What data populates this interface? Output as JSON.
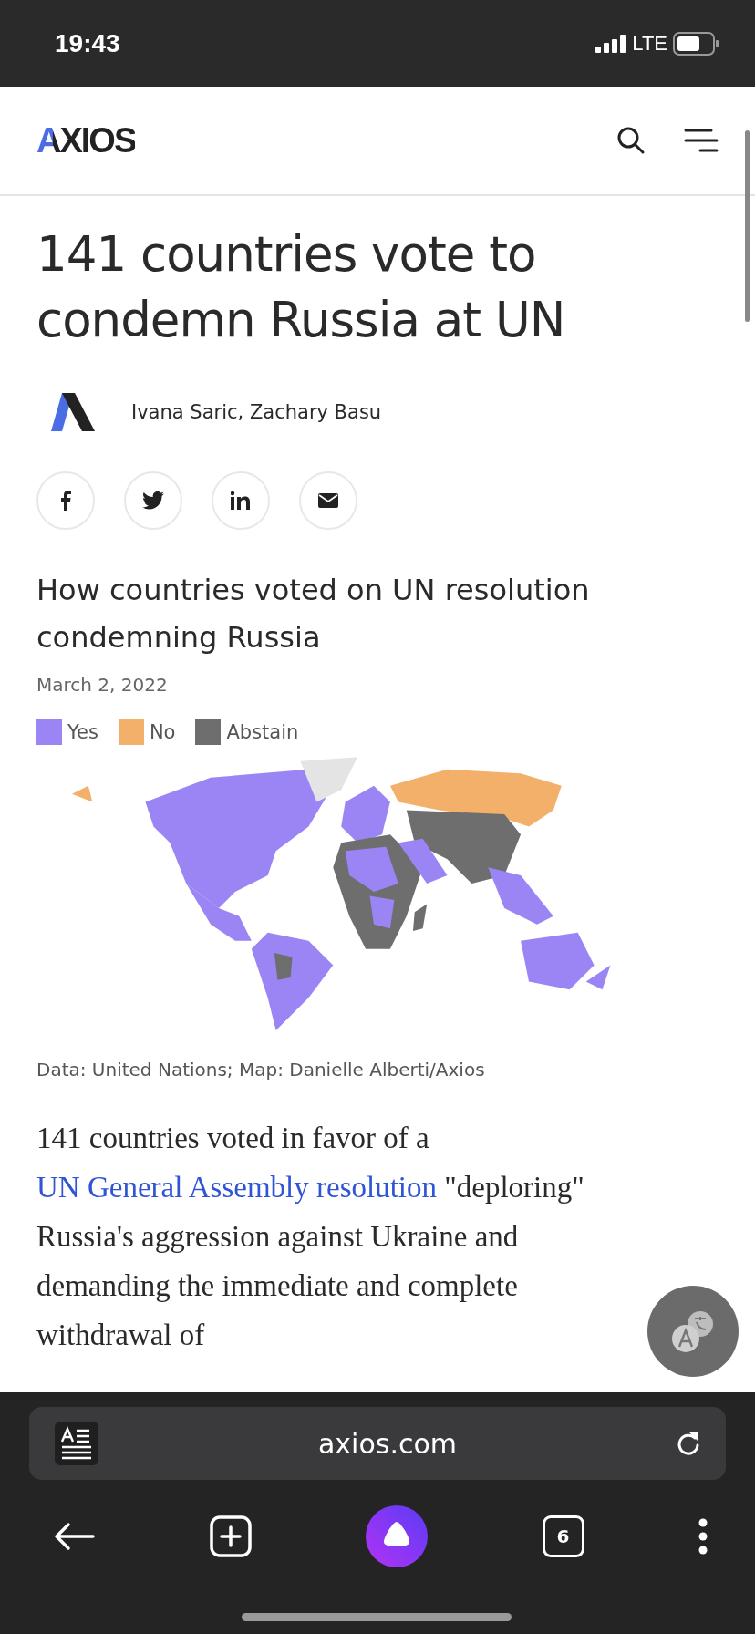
{
  "status_bar": {
    "time": "19:43",
    "network": "LTE"
  },
  "header": {
    "logo": "AXIOS"
  },
  "article": {
    "title": "141 countries vote to condemn Russia at UN",
    "authors": "Ivana Saric, Zachary Basu",
    "share_buttons": [
      {
        "kind": "facebook"
      },
      {
        "kind": "twitter"
      },
      {
        "kind": "linkedin"
      },
      {
        "kind": "email"
      }
    ],
    "chart": {
      "title": "How countries voted on UN resolution condemning Russia",
      "date": "March 2, 2022",
      "legend": [
        {
          "label": "Yes",
          "color": "#9b85f5"
        },
        {
          "label": "No",
          "color": "#f2b06a"
        },
        {
          "label": "Abstain",
          "color": "#6e6e6e"
        }
      ],
      "source": "Data: United Nations; Map: Danielle Alberti/Axios"
    },
    "paragraph": {
      "before": "141 countries voted in favor of a ",
      "link": "UN General Assembly resolution",
      "after": " \"deploring\" Russia's aggression against Ukraine and demanding the immediate and complete withdrawal of"
    }
  },
  "browser": {
    "url": "axios.com",
    "tab_count": "6"
  }
}
